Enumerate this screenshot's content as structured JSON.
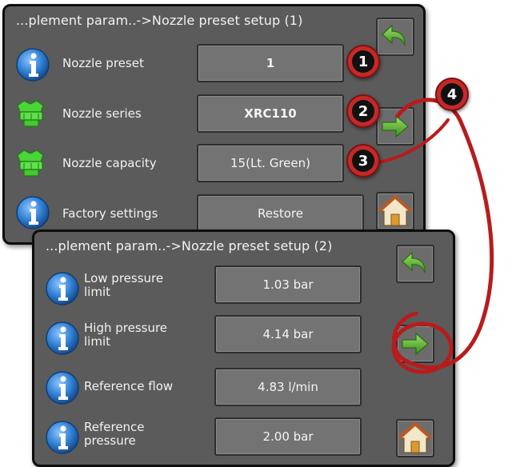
{
  "screen1": {
    "title": "...plement param..->Nozzle preset setup (1)",
    "rows": [
      {
        "icon": "info-icon",
        "label": "Nozzle preset",
        "value": "1"
      },
      {
        "icon": "nozzle-icon",
        "label": "Nozzle series",
        "value": "XRC110"
      },
      {
        "icon": "nozzle-icon",
        "label": "Nozzle capacity",
        "value": "15(Lt. Green)"
      },
      {
        "icon": "info-icon",
        "label": "Factory settings",
        "value": "Restore"
      }
    ],
    "buttons": {
      "back": "back-arrow-icon",
      "next": "next-arrow-icon",
      "home": "home-icon"
    }
  },
  "screen2": {
    "title": "...plement param..->Nozzle preset setup (2)",
    "rows": [
      {
        "icon": "info-icon",
        "label_line1": "Low pressure",
        "label_line2": "limit",
        "value": "1.03 bar"
      },
      {
        "icon": "info-icon",
        "label_line1": "High pressure",
        "label_line2": "limit",
        "value": "4.14 bar"
      },
      {
        "icon": "info-icon",
        "label_line1": "Reference flow",
        "label_line2": "",
        "value": "4.83 l/min"
      },
      {
        "icon": "info-icon",
        "label_line1": "Reference",
        "label_line2": "pressure",
        "value": "2.00 bar"
      }
    ],
    "buttons": {
      "back": "back-arrow-icon",
      "next": "next-arrow-icon",
      "home": "home-icon"
    }
  },
  "callouts": [
    "1",
    "2",
    "3",
    "4"
  ],
  "colors": {
    "panel": "#5b5b5b",
    "field": "#737373",
    "callout": "#c62828",
    "arrow": "#5cb531",
    "info": "#2f7fd4"
  }
}
